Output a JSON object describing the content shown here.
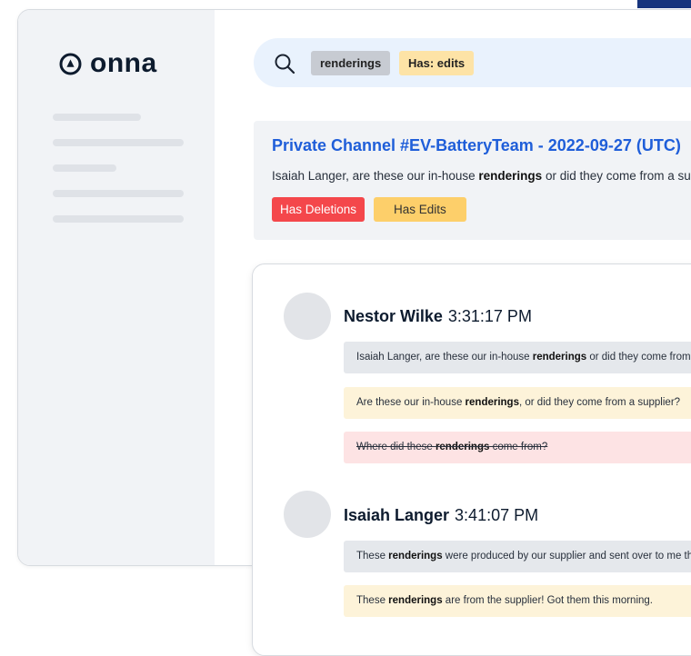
{
  "brand": {
    "name": "onna"
  },
  "search": {
    "chips": [
      "renderings",
      "Has: edits"
    ]
  },
  "result": {
    "title": "Private Channel #EV-BatteryTeam - 2022-09-27 (UTC)",
    "snippet": {
      "before": "Isaiah Langer, are these our in-house ",
      "highlight": "renderings",
      "after": " or did they come from a supplier?"
    },
    "tags": [
      "Has Deletions",
      "Has Edits"
    ]
  },
  "conversation": [
    {
      "author": "Nestor Wilke",
      "time": "3:31:17 PM",
      "messages": [
        {
          "status": "original",
          "before": "Isaiah Langer, are these our in-house ",
          "highlight": "renderings",
          "after": " or did they come from a supplier?"
        },
        {
          "status": "edited",
          "before": "Are these our in-house ",
          "highlight": "renderings",
          "after": ", or did they come from a supplier?"
        },
        {
          "status": "deleted",
          "before": "Where did these ",
          "highlight": "renderings",
          "after": " come from?"
        }
      ]
    },
    {
      "author": "Isaiah Langer",
      "time": "3:41:07 PM",
      "messages": [
        {
          "status": "original",
          "before": "These ",
          "highlight": "renderings",
          "after": " were produced by our supplier and sent over to me this morning."
        },
        {
          "status": "edited",
          "before": "These ",
          "highlight": "renderings",
          "after": " are from the supplier! Got them this morning."
        }
      ]
    }
  ],
  "colors": {
    "accent_blue": "#1f5ed9",
    "deleted_red": "#f4474b",
    "edited_yellow": "#fdcf6a",
    "search_bg": "#e9f2fd",
    "corner_navy": "#17357e"
  }
}
